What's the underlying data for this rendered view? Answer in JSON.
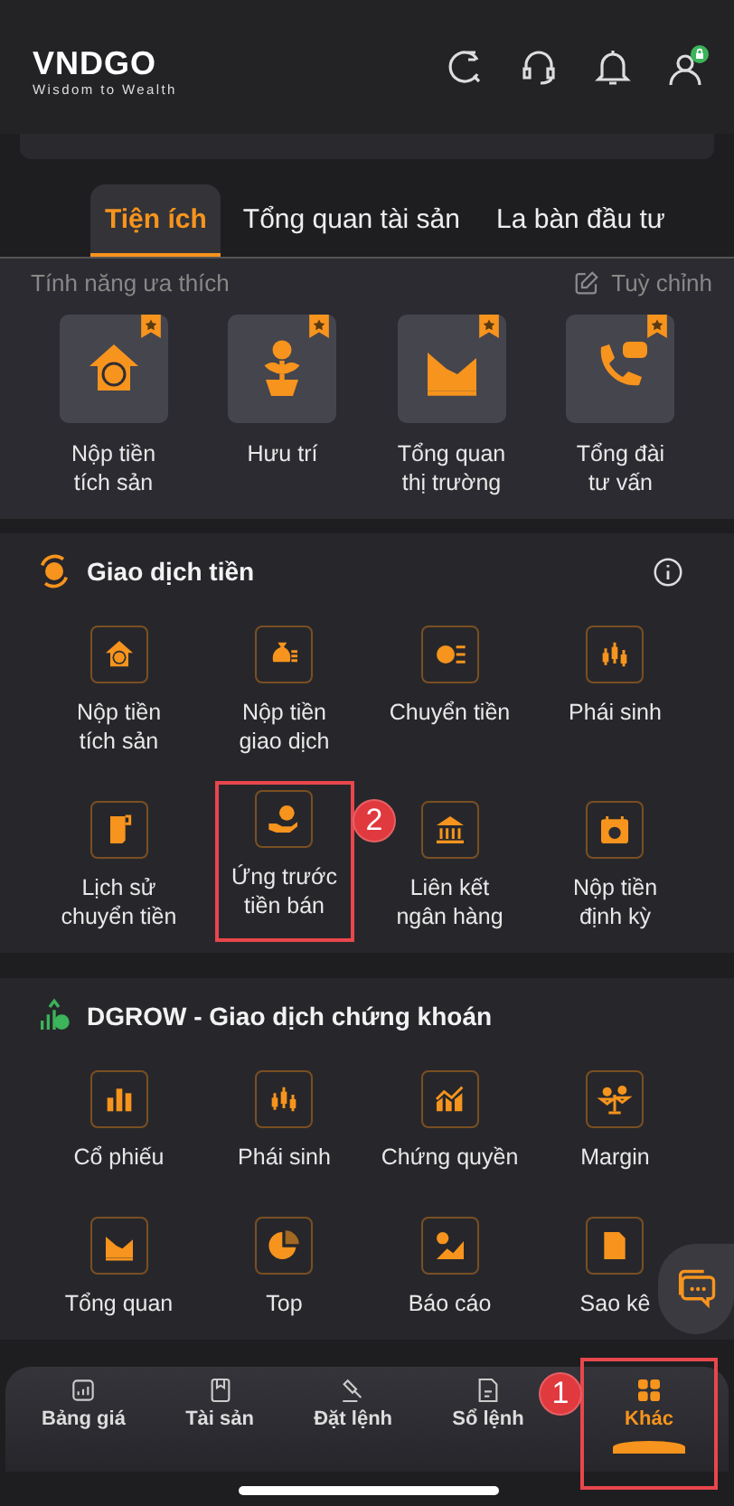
{
  "header": {
    "logo": "VNDGO",
    "tagline": "Wisdom to Wealth"
  },
  "tabs": [
    {
      "label": "Tiện ích",
      "selected": true
    },
    {
      "label": "Tổng quan tài sản",
      "selected": false
    },
    {
      "label": "La bàn đầu tư",
      "selected": false
    }
  ],
  "favorites": {
    "title": "Tính năng ưa thích",
    "edit_label": "Tuỳ chỉnh",
    "items": [
      {
        "label": "Nộp tiền\ntích sản"
      },
      {
        "label": "Hưu trí"
      },
      {
        "label": "Tổng quan\nthị trường"
      },
      {
        "label": "Tổng đài\ntư vấn"
      }
    ]
  },
  "sections": [
    {
      "title": "Giao dịch tiền",
      "items": [
        {
          "label": "Nộp tiền\ntích sản"
        },
        {
          "label": "Nộp tiền\ngiao dịch"
        },
        {
          "label": "Chuyển tiền"
        },
        {
          "label": "Phái sinh"
        },
        {
          "label": "Lịch sử\nchuyển tiền"
        },
        {
          "label": "Ứng trước\ntiền bán",
          "callout": "2"
        },
        {
          "label": "Liên kết\nngân hàng"
        },
        {
          "label": "Nộp tiền\nđịnh kỳ"
        }
      ]
    },
    {
      "title": "DGROW - Giao dịch chứng khoán",
      "items": [
        {
          "label": "Cổ phiếu"
        },
        {
          "label": "Phái sinh"
        },
        {
          "label": "Chứng quyền"
        },
        {
          "label": "Margin"
        },
        {
          "label": "Tổng quan"
        },
        {
          "label": "Top"
        },
        {
          "label": "Báo cáo"
        },
        {
          "label": "Sao kê"
        }
      ]
    }
  ],
  "nav": [
    {
      "label": "Bảng giá",
      "selected": false
    },
    {
      "label": "Tài sản",
      "selected": false
    },
    {
      "label": "Đặt lệnh",
      "selected": false
    },
    {
      "label": "Sổ lệnh",
      "selected": false
    },
    {
      "label": "Khác",
      "selected": true,
      "callout": "1"
    }
  ]
}
